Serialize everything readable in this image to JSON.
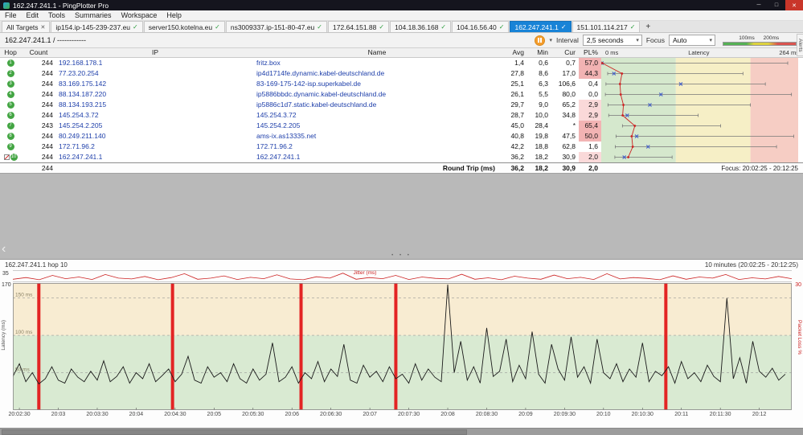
{
  "window": {
    "title": "162.247.241.1 - PingPlotter Pro"
  },
  "menu": {
    "items": [
      "File",
      "Edit",
      "Tools",
      "Summaries",
      "Workspace",
      "Help"
    ]
  },
  "tabs": {
    "all_targets": "All Targets",
    "items": [
      "ip154.ip-145-239-237.eu",
      "server150.kotelna.eu",
      "ns3009337.ip-151-80-47.eu",
      "172.64.151.88",
      "104.18.36.168",
      "104.16.56.40",
      "162.247.241.1",
      "151.101.114.217"
    ],
    "active": "162.247.241.1",
    "add_label": "+",
    "alerts_label": "Alerts"
  },
  "toolbar": {
    "target": "162.247.241.1 / ------------",
    "interval_label": "Interval",
    "interval_value": "2,5 seconds",
    "focus_label": "Focus",
    "focus_value": "Auto",
    "legend_100": "100ms",
    "legend_200": "200ms"
  },
  "table": {
    "headers": {
      "hop": "Hop",
      "count": "Count",
      "ip": "IP",
      "name": "Name",
      "avg": "Avg",
      "min": "Min",
      "cur": "Cur",
      "pl": "PL%",
      "latency": "Latency",
      "scale_min": "0 ms",
      "scale_max": "264 ms"
    },
    "rows": [
      {
        "hop": "1",
        "count": "244",
        "ip": "192.168.178.1",
        "name": "fritz.box",
        "avg": "1,4",
        "min": "0,6",
        "cur": "0,7",
        "pl": "57,0"
      },
      {
        "hop": "2",
        "count": "244",
        "ip": "77.23.20.254",
        "name": "ip4d1714fe.dynamic.kabel-deutschland.de",
        "avg": "27,8",
        "min": "8,6",
        "cur": "17,0",
        "pl": "44,3"
      },
      {
        "hop": "3",
        "count": "244",
        "ip": "83.169.175.142",
        "name": "83-169-175-142-isp.superkabel.de",
        "avg": "25,1",
        "min": "6,3",
        "cur": "106,6",
        "pl": "0,4"
      },
      {
        "hop": "4",
        "count": "244",
        "ip": "88.134.187.220",
        "name": "ip5886bbdc.dynamic.kabel-deutschland.de",
        "avg": "26,1",
        "min": "5,5",
        "cur": "80,0",
        "pl": "0,0"
      },
      {
        "hop": "5",
        "count": "244",
        "ip": "88.134.193.215",
        "name": "ip5886c1d7.static.kabel-deutschland.de",
        "avg": "29,7",
        "min": "9,0",
        "cur": "65,2",
        "pl": "2,9"
      },
      {
        "hop": "6",
        "count": "244",
        "ip": "145.254.3.72",
        "name": "145.254.3.72",
        "avg": "28,7",
        "min": "10,0",
        "cur": "34,8",
        "pl": "2,9"
      },
      {
        "hop": "7",
        "count": "243",
        "ip": "145.254.2.205",
        "name": "145.254.2.205",
        "avg": "45,0",
        "min": "28,4",
        "cur": "*",
        "pl": "65,4"
      },
      {
        "hop": "8",
        "count": "244",
        "ip": "80.249.211.140",
        "name": "ams-ix.as13335.net",
        "avg": "40,8",
        "min": "19,8",
        "cur": "47,5",
        "pl": "50,0"
      },
      {
        "hop": "9",
        "count": "244",
        "ip": "172.71.96.2",
        "name": "172.71.96.2",
        "avg": "42,2",
        "min": "18,8",
        "cur": "62,8",
        "pl": "1,6"
      },
      {
        "hop": "10",
        "count": "244",
        "ip": "162.247.241.1",
        "name": "162.247.241.1",
        "avg": "36,2",
        "min": "18,2",
        "cur": "30,9",
        "pl": "2,0"
      }
    ],
    "round_trip": {
      "count": "244",
      "label": "Round Trip (ms)",
      "avg": "36,2",
      "min": "18,2",
      "cur": "30,9",
      "pl": "2,0",
      "focus": "Focus: 20:02:25 - 20:12:25"
    }
  },
  "graph": {
    "title": "162.247.241.1 hop 10",
    "range": "10 minutes (20:02:25 - 20:12:25)",
    "jitter_label": "Jitter (ms)",
    "jitter_max": "35",
    "latency_max": "170",
    "loss_max": "30",
    "left_label": "Latency (ms)",
    "right_label": "Packet Loss %"
  },
  "chart_data": [
    {
      "type": "line",
      "name": "latency-timeline",
      "title": "162.247.241.1 hop 10",
      "x_start": "20:02:25",
      "x_end": "20:12:25",
      "duration_s": 600,
      "step_s": 5,
      "ylim": [
        0,
        170
      ],
      "ylabel": "Latency (ms)",
      "ylabel_right": "Packet Loss %",
      "grid": [
        {
          "v": 50,
          "label": "50 ms"
        },
        {
          "v": 100,
          "label": "100 ms"
        },
        {
          "v": 150,
          "label": "150 ms"
        }
      ],
      "zones": [
        {
          "from": 0,
          "to": 100,
          "color": "#d9ead2"
        },
        {
          "from": 100,
          "to": 170,
          "color": "#f8ecd2"
        }
      ],
      "loss_bars_s": [
        20,
        123,
        222,
        295,
        503
      ],
      "x_tick_s": [
        5,
        35,
        65,
        95,
        125,
        155,
        185,
        215,
        245,
        275,
        305,
        335,
        365,
        395,
        425,
        455,
        485,
        515,
        545,
        575
      ],
      "x_tick_labels": [
        "20:02:30",
        "20:03",
        "20:03:30",
        "20:04",
        "20:04:30",
        "20:05",
        "20:05:30",
        "20:06",
        "20:06:30",
        "20:07",
        "20:07:30",
        "20:08",
        "20:08:30",
        "20:09",
        "20:09:30",
        "20:10",
        "20:10:30",
        "20:11",
        "20:11:30",
        "20:12"
      ],
      "values": [
        45,
        62,
        38,
        50,
        35,
        42,
        58,
        40,
        36,
        55,
        44,
        38,
        52,
        40,
        66,
        38,
        45,
        58,
        36,
        50,
        42,
        62,
        38,
        46,
        55,
        38,
        48,
        72,
        40,
        36,
        58,
        44,
        50,
        38,
        62,
        42,
        36,
        55,
        40,
        48,
        90,
        38,
        44,
        58,
        36,
        50,
        42,
        65,
        38,
        55,
        45,
        88,
        40,
        36,
        60,
        44,
        52,
        38,
        58,
        42,
        48,
        36,
        62,
        40,
        55,
        44,
        38,
        168,
        50,
        92,
        40,
        58,
        36,
        110,
        45,
        52,
        95,
        38,
        60,
        42,
        105,
        48,
        36,
        88,
        55,
        40,
        98,
        44,
        58,
        36,
        95,
        50,
        42,
        62,
        38,
        55,
        44,
        90,
        38,
        52,
        46,
        58,
        36,
        65,
        42,
        50,
        38,
        60,
        45,
        38,
        150,
        42,
        70,
        36,
        92,
        52,
        44,
        56,
        40,
        48
      ]
    },
    {
      "type": "range-scatter",
      "name": "hop-latency-summary",
      "xlim": [
        0,
        264
      ],
      "zone_bounds_ms": [
        100,
        200,
        264
      ],
      "zone_colors": [
        "#d5e8cd",
        "#f6efc6",
        "#f6cdc4"
      ],
      "avg": [
        1.4,
        27.8,
        25.1,
        26.1,
        29.7,
        28.7,
        45.0,
        40.8,
        42.2,
        36.2
      ],
      "min": [
        0.6,
        8.6,
        6.3,
        5.5,
        9.0,
        10.0,
        28.4,
        19.8,
        18.8,
        18.2
      ],
      "cur": [
        0.7,
        17.0,
        106.6,
        80.0,
        65.2,
        34.8,
        null,
        47.5,
        62.8,
        30.9
      ],
      "max_est": [
        250,
        190,
        220,
        255,
        200,
        130,
        160,
        258,
        235,
        95
      ]
    },
    {
      "type": "line",
      "name": "jitter-strip",
      "ylim": [
        0,
        35
      ],
      "values": [
        8,
        14,
        6,
        22,
        10,
        16,
        7,
        25,
        12,
        9,
        18,
        6,
        14,
        28,
        8,
        12,
        20,
        7,
        15,
        10,
        24,
        9,
        6,
        17,
        12,
        30,
        8,
        14,
        10,
        22,
        7,
        16,
        11,
        9,
        26,
        8,
        13,
        6,
        19,
        12,
        8,
        23,
        10,
        15,
        7,
        28,
        9,
        14,
        11,
        6,
        20,
        8,
        16,
        12,
        25,
        7,
        13,
        9,
        18,
        10
      ]
    }
  ]
}
